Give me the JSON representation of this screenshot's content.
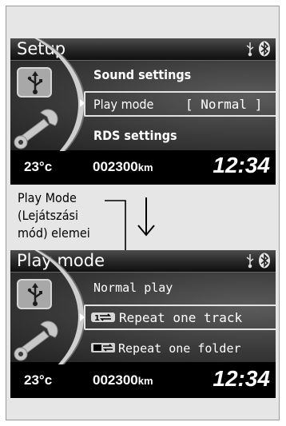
{
  "screens": [
    {
      "title": "Setup",
      "items": [
        {
          "label": "Sound settings"
        },
        {
          "label": "Play mode",
          "value": "[ Normal ]",
          "selected": true
        },
        {
          "label": "RDS settings"
        }
      ],
      "temperature": "23°c",
      "odometer": "002300",
      "odometer_unit": "km",
      "clock": "12:34"
    },
    {
      "title": "Play mode",
      "items": [
        {
          "label": "Normal play"
        },
        {
          "label": "Repeat one track",
          "icon": "repeat-track-icon",
          "selected": true
        },
        {
          "label": "Repeat one folder",
          "icon": "repeat-folder-icon"
        }
      ],
      "temperature": "23°c",
      "odometer": "002300",
      "odometer_unit": "km",
      "clock": "12:34"
    }
  ],
  "annotation": {
    "line1": "Play Mode",
    "line2": "(Lejátszási",
    "line3": "mód) elemei"
  },
  "icons": [
    "usb-icon",
    "bluetooth-icon",
    "wrench-icon",
    "down-arrow-icon"
  ]
}
